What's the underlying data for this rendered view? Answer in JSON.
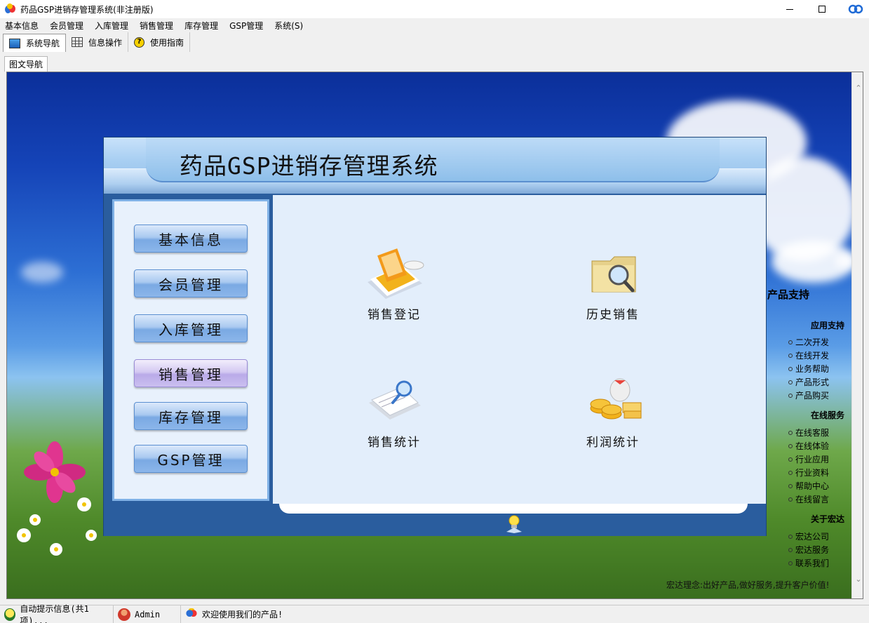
{
  "window": {
    "title": "药品GSP进销存管理系统(非注册版)"
  },
  "menu": [
    "基本信息",
    "会员管理",
    "入库管理",
    "销售管理",
    "库存管理",
    "GSP管理",
    "系统(S)"
  ],
  "toolbar": [
    {
      "label": "系统导航",
      "icon": "nav-window-icon"
    },
    {
      "label": "信息操作",
      "icon": "grid-icon"
    },
    {
      "label": "使用指南",
      "icon": "help-icon"
    }
  ],
  "tab": "图文导航",
  "panel": {
    "title": "药品GSP进销存管理系统",
    "nav": [
      {
        "label": "基本信息",
        "active": false
      },
      {
        "label": "会员管理",
        "active": false
      },
      {
        "label": "入库管理",
        "active": false
      },
      {
        "label": "销售管理",
        "active": true
      },
      {
        "label": "库存管理",
        "active": false
      },
      {
        "label": "GSP管理",
        "active": false
      }
    ],
    "functions": [
      {
        "label": "销售登记",
        "icon": "sales-register-icon"
      },
      {
        "label": "历史销售",
        "icon": "history-search-icon"
      },
      {
        "label": "销售统计",
        "icon": "sales-stats-icon"
      },
      {
        "label": "利润统计",
        "icon": "profit-coins-icon"
      }
    ]
  },
  "side": {
    "title": "产品支持",
    "sections": [
      {
        "head": "应用支持",
        "links": [
          "二次开发",
          "在线开发",
          "业务帮助",
          "产品形式",
          "产品购买"
        ]
      },
      {
        "head": "在线服务",
        "links": [
          "在线客服",
          "在线体验",
          "行业应用",
          "行业资料",
          "帮助中心",
          "在线留言"
        ]
      },
      {
        "head": "关于宏达",
        "links": [
          "宏达公司",
          "宏达服务",
          "联系我们"
        ]
      }
    ],
    "note": "宏达理念:出好产品,做好服务,提升客户价值!"
  },
  "status": {
    "tip": "自动提示信息(共1项)...",
    "user": "Admin",
    "welcome": "欢迎使用我们的产品!"
  },
  "colors": {
    "panel_blue": "#2a5d9e",
    "active_nav": "#cbbff0"
  }
}
